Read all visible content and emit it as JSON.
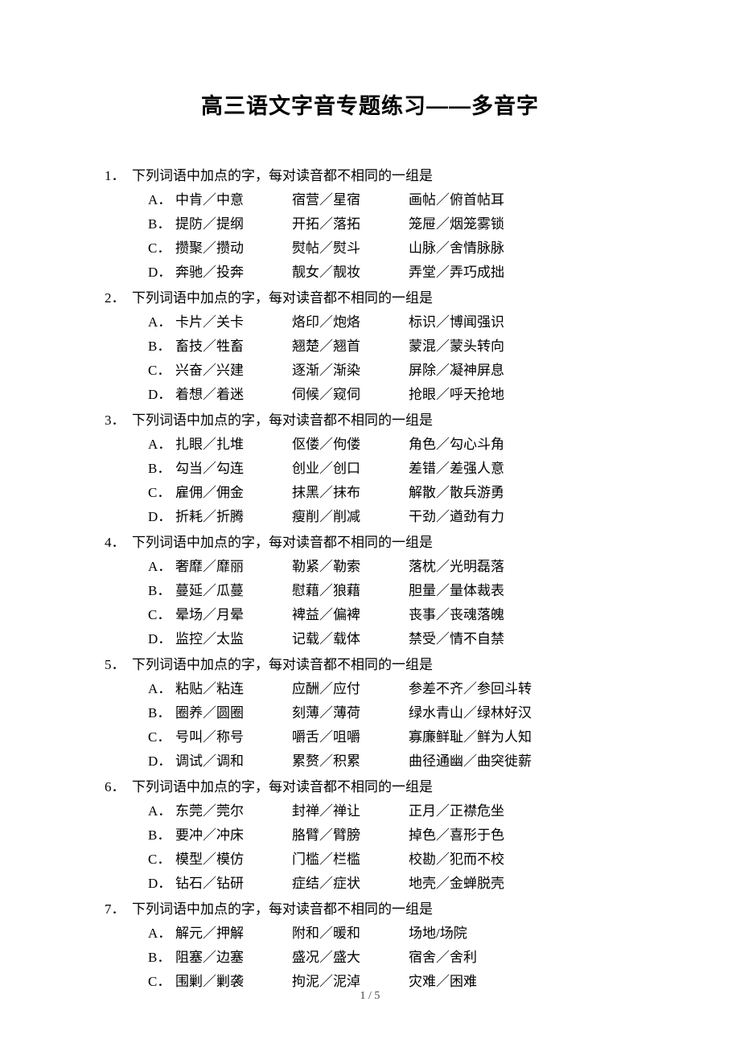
{
  "title": "高三语文字音专题练习——多音字",
  "stem": "下列词语中加点的字，每对读音都不相同的一组是",
  "questions": [
    {
      "num": "1．",
      "options": [
        {
          "letter": "A．",
          "p1": "中肯／中意",
          "p2": "宿营／星宿",
          "p3": "画帖／俯首帖耳"
        },
        {
          "letter": "B．",
          "p1": "提防／提纲",
          "p2": "开拓／落拓",
          "p3": "笼屉／烟笼雾锁"
        },
        {
          "letter": "C．",
          "p1": "攒聚／攒动",
          "p2": "熨帖／熨斗",
          "p3": "山脉／舍情脉脉"
        },
        {
          "letter": "D．",
          "p1": "奔驰／投奔",
          "p2": "靓女／靓妆",
          "p3": "弄堂／弄巧成拙"
        }
      ]
    },
    {
      "num": "2．",
      "options": [
        {
          "letter": "A．",
          "p1": "卡片／关卡",
          "p2": "烙印／炮烙",
          "p3": "标识／博闻强识"
        },
        {
          "letter": "B．",
          "p1": "畜技／牲畜",
          "p2": "翘楚／翘首",
          "p3": "蒙混／蒙头转向"
        },
        {
          "letter": "C．",
          "p1": "兴奋／兴建",
          "p2": "逐渐／渐染",
          "p3": "屏除／凝神屏息"
        },
        {
          "letter": "D．",
          "p1": "着想／着迷",
          "p2": "伺候／窥伺",
          "p3": "抢眼／呼天抢地"
        }
      ]
    },
    {
      "num": "3．",
      "options": [
        {
          "letter": "A．",
          "p1": "扎眼／扎堆",
          "p2": "伛偻／佝偻",
          "p3": "角色／勾心斗角"
        },
        {
          "letter": "B．",
          "p1": "勾当／勾连",
          "p2": "创业／创口",
          "p3": "差错／差强人意"
        },
        {
          "letter": "C．",
          "p1": "雇佣／佣金",
          "p2": "抹黑／抹布",
          "p3": "解散／散兵游勇"
        },
        {
          "letter": "D．",
          "p1": "折耗／折腾",
          "p2": "瘦削／削减",
          "p3": "干劲／遒劲有力"
        }
      ]
    },
    {
      "num": "4．",
      "options": [
        {
          "letter": "A．",
          "p1": "奢靡／靡丽",
          "p2": "勒紧／勒索",
          "p3": "落枕／光明磊落"
        },
        {
          "letter": "B．",
          "p1": "蔓延／瓜蔓",
          "p2": "慰藉／狼藉",
          "p3": "胆量／量体裁表"
        },
        {
          "letter": "C．",
          "p1": "晕场／月晕",
          "p2": "裨益／偏裨",
          "p3": "丧事／丧魂落魄"
        },
        {
          "letter": "D．",
          "p1": "监控／太监",
          "p2": "记载／载体",
          "p3": "禁受／情不自禁"
        }
      ]
    },
    {
      "num": "5．",
      "options": [
        {
          "letter": "A．",
          "p1": "粘贴／粘连",
          "p2": "应酬／应付",
          "p3": "参差不齐／参回斗转"
        },
        {
          "letter": "B．",
          "p1": "圈养／圆圈",
          "p2": "刻薄／薄荷",
          "p3": "绿水青山／绿林好汉"
        },
        {
          "letter": "C．",
          "p1": "号叫／称号",
          "p2": "嚼舌／咀嚼",
          "p3": "寡廉鲜耻／鲜为人知"
        },
        {
          "letter": "D．",
          "p1": "调试／调和",
          "p2": "累赘／积累",
          "p3": "曲径通幽／曲突徙薪"
        }
      ]
    },
    {
      "num": "6．",
      "options": [
        {
          "letter": "A．",
          "p1": "东莞／莞尔",
          "p2": "封禅／禅让",
          "p3": "正月／正襟危坐"
        },
        {
          "letter": "B．",
          "p1": "要冲／冲床",
          "p2": "胳臂／臂膀",
          "p3": "掉色／喜形于色"
        },
        {
          "letter": "C．",
          "p1": "模型／模仿",
          "p2": "门槛／栏槛",
          "p3": "校勘／犯而不校"
        },
        {
          "letter": "D．",
          "p1": "钻石／钻研",
          "p2": "症结／症状",
          "p3": "地壳／金蝉脱壳"
        }
      ]
    },
    {
      "num": "7．",
      "options": [
        {
          "letter": "A．",
          "p1": "解元／押解",
          "p2": "附和／暖和",
          "p3": "场地/场院"
        },
        {
          "letter": "B．",
          "p1": "阻塞／边塞",
          "p2": "盛况／盛大",
          "p3": "宿舍／舍利"
        },
        {
          "letter": "C．",
          "p1": "围剿／剿袭",
          "p2": "拘泥／泥淖",
          "p3": "灾难／困难"
        }
      ]
    }
  ],
  "footer": "1 / 5"
}
